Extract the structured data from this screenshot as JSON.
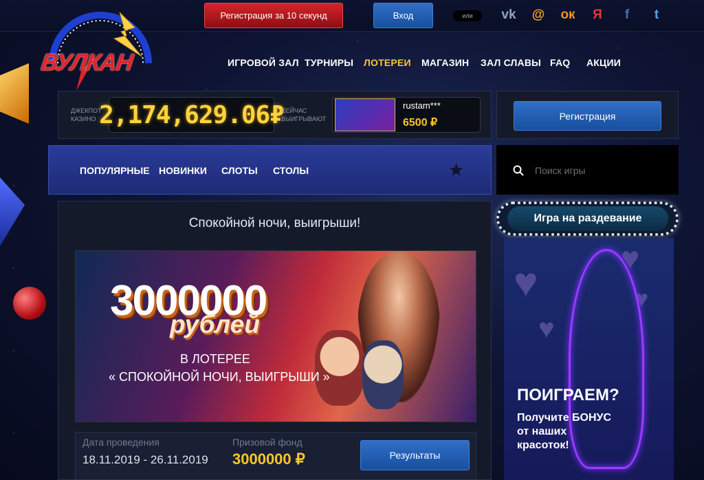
{
  "header": {
    "register_label": "Регистрация за 10 секунд",
    "login_label": "Вход",
    "or_label": "или",
    "social": [
      {
        "icon": "vk-icon",
        "glyph": "vk",
        "color": "#8ea5c4"
      },
      {
        "icon": "mail-icon",
        "glyph": "@",
        "color": "#f5a623"
      },
      {
        "icon": "odnoklassniki-icon",
        "glyph": "ок",
        "color": "#f7931e"
      },
      {
        "icon": "yandex-icon",
        "glyph": "Я",
        "color": "#e53935"
      },
      {
        "icon": "facebook-icon",
        "glyph": "f",
        "color": "#4b6fb4"
      },
      {
        "icon": "twitter-icon",
        "glyph": "t",
        "color": "#4aa8ea"
      }
    ]
  },
  "logo": {
    "text": "ВУЛКАН"
  },
  "nav": {
    "items": [
      {
        "label": "ИГРОВОЙ ЗАЛ",
        "active": false
      },
      {
        "label": "ТУРНИРЫ",
        "active": false
      },
      {
        "label": "ЛОТЕРЕИ",
        "active": true
      },
      {
        "label": "МАГАЗИН",
        "active": false
      },
      {
        "label": "ЗАЛ СЛАВЫ",
        "active": false
      },
      {
        "label": "FAQ",
        "active": false
      },
      {
        "label": "АКЦИИ",
        "active": false
      }
    ],
    "active_color": "#f5c542"
  },
  "jackpot": {
    "label_line1": "ДЖЕКПОТ",
    "label_line2": "КАЗИНО",
    "value": "2,174,629.06₽"
  },
  "winner": {
    "label_line1": "СЕЙЧАС",
    "label_line2": "ВЫИГРЫВАЮТ",
    "user": "rustam***",
    "amount": "6500 ₽"
  },
  "sidebar": {
    "register_label": "Регистрация",
    "search_placeholder": "Поиск игры",
    "promo_header": "Игра на раздевание",
    "promo_title": "ПОИГРАЕМ?",
    "promo_text_line1": "Получите БОНУС",
    "promo_text_line2": "от наших",
    "promo_text_line3": "красоток!"
  },
  "categories": {
    "items": [
      "ПОПУЛЯРНЫЕ",
      "НОВИНКИ",
      "СЛОТЫ",
      "СТОЛЫ"
    ]
  },
  "lottery": {
    "title": "Спокойной ночи, выигрыши!",
    "banner_amount": "3000000",
    "banner_currency": "рублей",
    "banner_line1": "В ЛОТЕРЕЕ",
    "banner_line2": "« СПОКОЙНОЙ НОЧИ, ВЫИГРЫШИ »",
    "date_label": "Дата проведения",
    "date_value": "18.11.2019 - 26.11.2019",
    "fund_label": "Призовой фонд",
    "fund_value": "3000000 ₽",
    "results_label": "Результаты"
  }
}
